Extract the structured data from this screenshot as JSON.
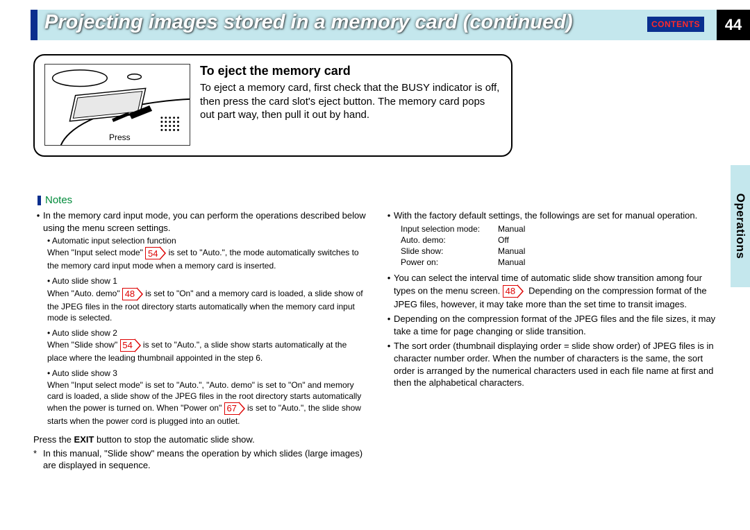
{
  "header": {
    "title": "Projecting images stored in a memory card (continued)",
    "contents_label": "CONTENTS",
    "page_number": "44"
  },
  "side_tab": "Operations",
  "eject": {
    "heading": "To eject the memory card",
    "body": "To eject a memory card, first check that the BUSY indicator is off, then press the card slot's eject button. The memory card pops out part way, then pull it out by hand.",
    "press_label": "Press"
  },
  "notes_label": "Notes",
  "left_col": {
    "intro": "In the memory card input mode, you can perform the operations described below using the menu screen settings.",
    "sub1_title": "Automatic input selection function",
    "sub1_body_a": "When \"Input select mode\"",
    "sub1_ref": "54",
    "sub1_body_b": "is set to \"Auto.\", the mode automatically switches to the memory card input mode when a memory card is inserted.",
    "sub2_title": "Auto slide show 1",
    "sub2_body_a": "When \"Auto. demo\"",
    "sub2_ref": "48",
    "sub2_body_b": "is set to \"On\" and a memory card is loaded, a slide show of the JPEG files in the root directory starts automatically when the memory card input mode is selected.",
    "sub3_title": "Auto slide show 2",
    "sub3_body_a": "When \"Slide show\"",
    "sub3_ref": "54",
    "sub3_body_b": "is set to \"Auto.\", a slide show starts automatically at the place where the leading thumbnail appointed in the step 6.",
    "sub4_title": "Auto slide show 3",
    "sub4_body_a": "When \"Input select mode\" is set to \"Auto.\", \"Auto. demo\" is set to \"On\" and memory card is loaded, a slide show of the JPEG files in the root directory starts automatically when the power is turned on. When \"Power on\"",
    "sub4_ref": "67",
    "sub4_body_b": "is set to \"Auto.\", the slide show starts when the power cord is plugged into an outlet.",
    "press_exit_a": "Press the ",
    "press_exit_b": "EXIT",
    "press_exit_c": " button to stop the automatic slide show.",
    "footnote": "In this manual, \"Slide show\" means the operation by which slides (large images) are displayed in sequence."
  },
  "right_col": {
    "r1": "With the factory default settings, the followings are set for manual operation.",
    "settings": [
      {
        "k": "Input selection mode:",
        "v": "Manual"
      },
      {
        "k": "Auto. demo:",
        "v": "Off"
      },
      {
        "k": "Slide show:",
        "v": "Manual"
      },
      {
        "k": "Power on:",
        "v": "Manual"
      }
    ],
    "r2_a": "You can select the interval time of automatic slide show transition among four types on the menu screen.",
    "r2_ref": "48",
    "r2_b": "Depending on the compression format of the JPEG files, however, it may take more than the set time to transit images.",
    "r3": "Depending on the compression format of the JPEG files and the file sizes, it may take a time for page changing or slide transition.",
    "r4": "The sort order (thumbnail displaying order = slide show order) of JPEG files is in character number order. When the number of characters is the same, the sort order is arranged by the numerical characters used in each file name at first and then the alphabetical characters."
  }
}
